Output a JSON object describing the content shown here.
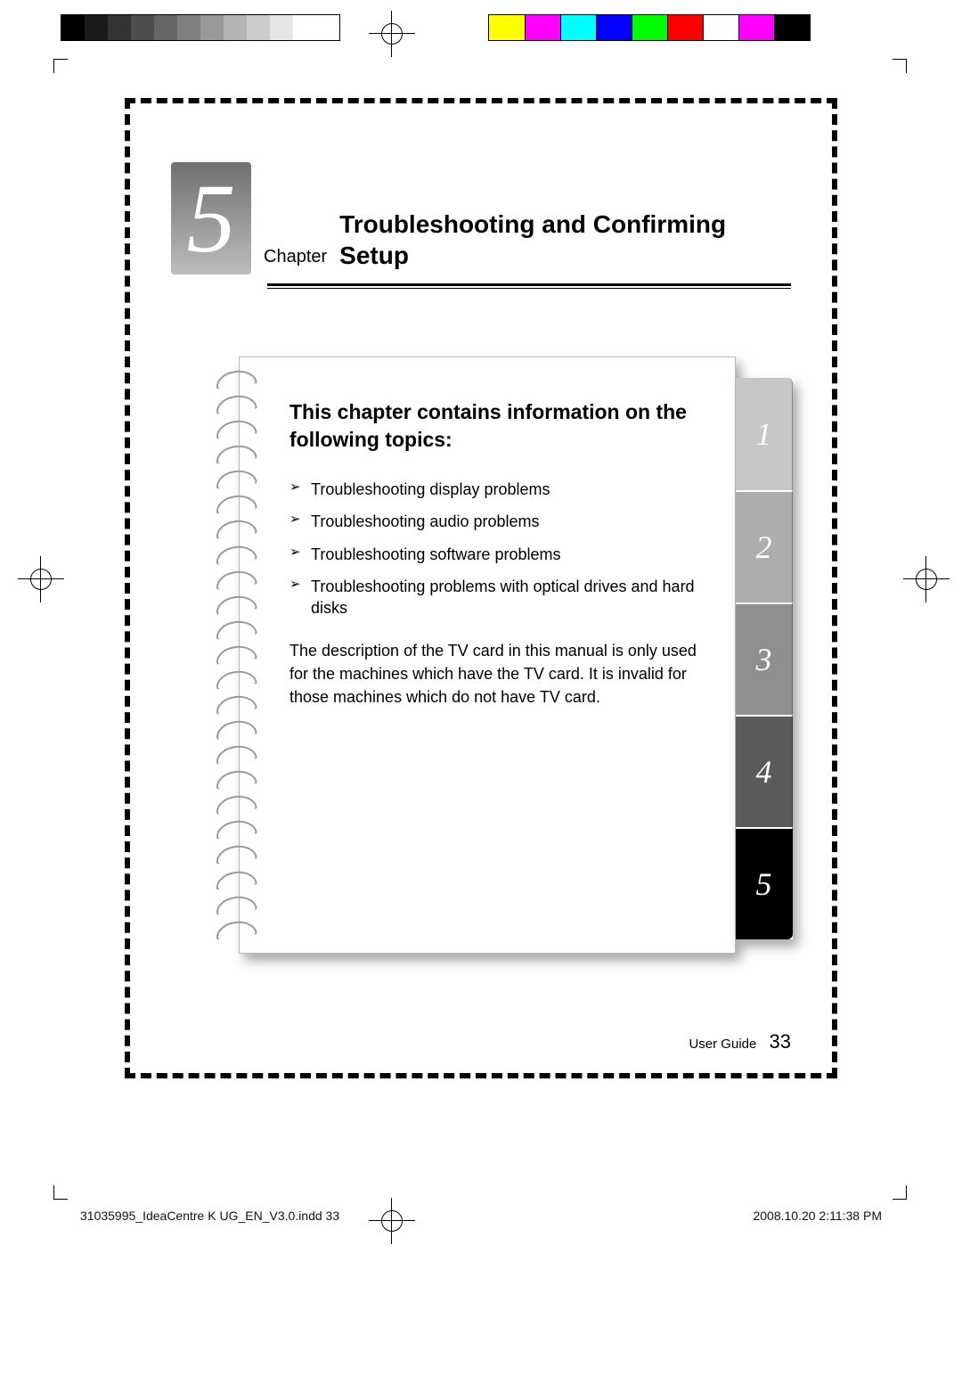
{
  "calibration": {
    "grays": [
      "#000000",
      "#1a1a1a",
      "#333333",
      "#4d4d4d",
      "#666666",
      "#808080",
      "#999999",
      "#b3b3b3",
      "#cccccc",
      "#e6e6e6",
      "#ffffff",
      "#ffffff"
    ],
    "colors": [
      "#ffff00",
      "#ff00ff",
      "#00ffff",
      "#0000ff",
      "#00ff00",
      "#ff0000",
      "#ffffff",
      "#ff00ff",
      "#000000"
    ]
  },
  "chapter": {
    "number": "5",
    "label": "Chapter",
    "title": "Troubleshooting and Confirming Setup"
  },
  "card": {
    "heading": "This chapter contains information on the following topics:",
    "topics": [
      "Troubleshooting display problems",
      "Troubleshooting audio problems",
      "Troubleshooting software problems",
      "Troubleshooting problems with optical drives and hard disks"
    ],
    "note": "The description of the TV card in this manual is only used for the machines which have the TV card. It is invalid for those machines which do not have TV card."
  },
  "tabs": [
    {
      "label": "1",
      "bg": "#c7c7c7"
    },
    {
      "label": "2",
      "bg": "#adadad"
    },
    {
      "label": "3",
      "bg": "#8f8f8f"
    },
    {
      "label": "4",
      "bg": "#5a5a5a"
    },
    {
      "label": "5",
      "bg": "#000000"
    }
  ],
  "footer": {
    "label": "User Guide",
    "page_number": "33"
  },
  "slug": {
    "filename": "31035995_IdeaCentre K UG_EN_V3.0.indd   33",
    "timestamp": "2008.10.20   2:11:38 PM"
  }
}
